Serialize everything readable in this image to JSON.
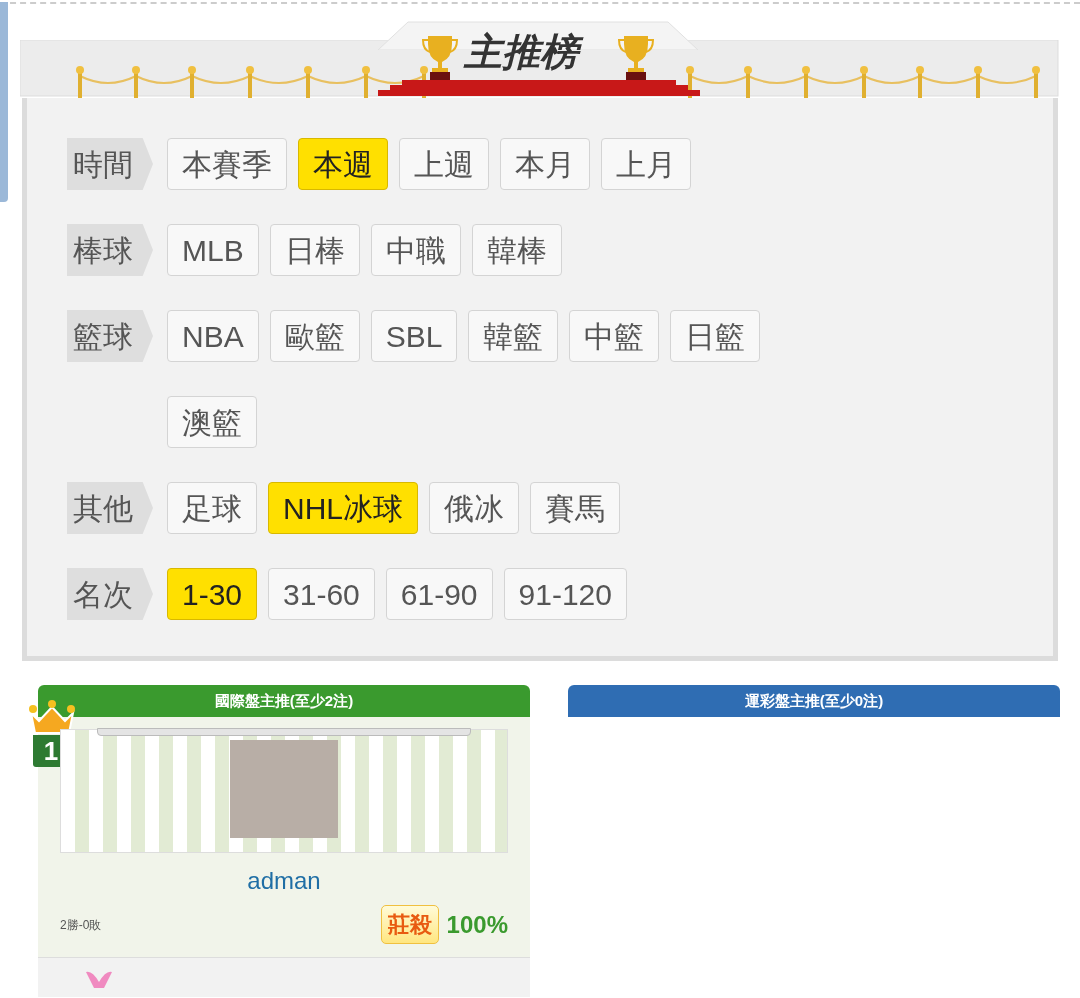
{
  "banner": {
    "title": "主推榜"
  },
  "filters": [
    {
      "label": "時間",
      "options": [
        {
          "text": "本賽季",
          "selected": false
        },
        {
          "text": "本週",
          "selected": true
        },
        {
          "text": "上週",
          "selected": false
        },
        {
          "text": "本月",
          "selected": false
        },
        {
          "text": "上月",
          "selected": false
        }
      ]
    },
    {
      "label": "棒球",
      "options": [
        {
          "text": "MLB",
          "selected": false
        },
        {
          "text": "日棒",
          "selected": false
        },
        {
          "text": "中職",
          "selected": false
        },
        {
          "text": "韓棒",
          "selected": false
        }
      ]
    },
    {
      "label": "籃球",
      "options": [
        {
          "text": "NBA",
          "selected": false
        },
        {
          "text": "歐籃",
          "selected": false
        },
        {
          "text": "SBL",
          "selected": false
        },
        {
          "text": "韓籃",
          "selected": false
        },
        {
          "text": "中籃",
          "selected": false
        },
        {
          "text": "日籃",
          "selected": false
        },
        {
          "text": "澳籃",
          "selected": false
        }
      ]
    },
    {
      "label": "其他",
      "options": [
        {
          "text": "足球",
          "selected": false
        },
        {
          "text": "NHL冰球",
          "selected": true
        },
        {
          "text": "俄冰",
          "selected": false
        },
        {
          "text": "賽馬",
          "selected": false
        }
      ]
    },
    {
      "label": "名次",
      "options": [
        {
          "text": "1-30",
          "selected": true
        },
        {
          "text": "31-60",
          "selected": false
        },
        {
          "text": "61-90",
          "selected": false
        },
        {
          "text": "91-120",
          "selected": false
        }
      ]
    }
  ],
  "panels": [
    {
      "title": "國際盤主推(至少2注)",
      "color": "#3a9a2e",
      "entries": [
        {
          "rank": "1",
          "name": "adman",
          "record": "2勝-0敗",
          "badge": "莊殺",
          "rate": "100%"
        }
      ],
      "more": true
    },
    {
      "title": "運彩盤主推(至少0注)",
      "color": "#2f6db3",
      "more": false
    }
  ]
}
